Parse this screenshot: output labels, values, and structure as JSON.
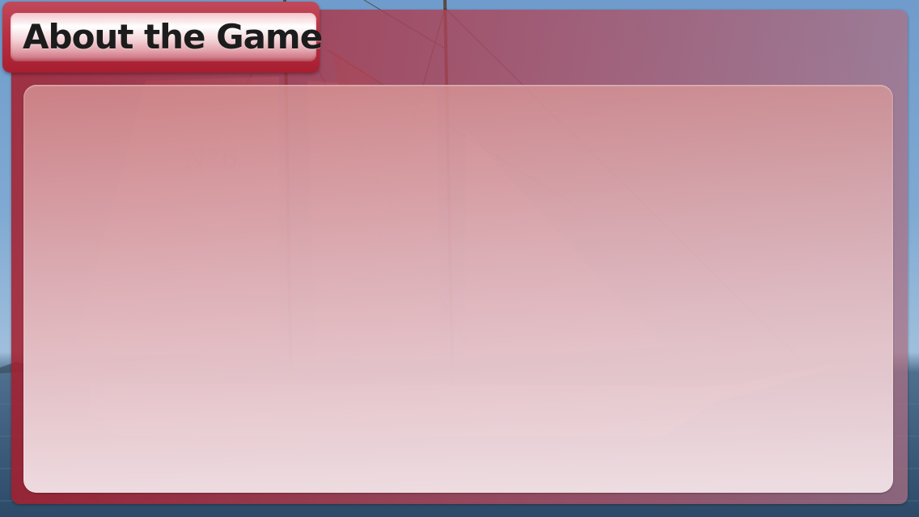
{
  "screen": {
    "title": "About the Game",
    "background": "sailing-ship-photo",
    "colors": {
      "panel": "#a81e31",
      "title_bar_highlight": "#ffffff",
      "title_text": "#1c1c1c",
      "sky": "#7fa9d2",
      "sea": "#2c4a68"
    }
  }
}
